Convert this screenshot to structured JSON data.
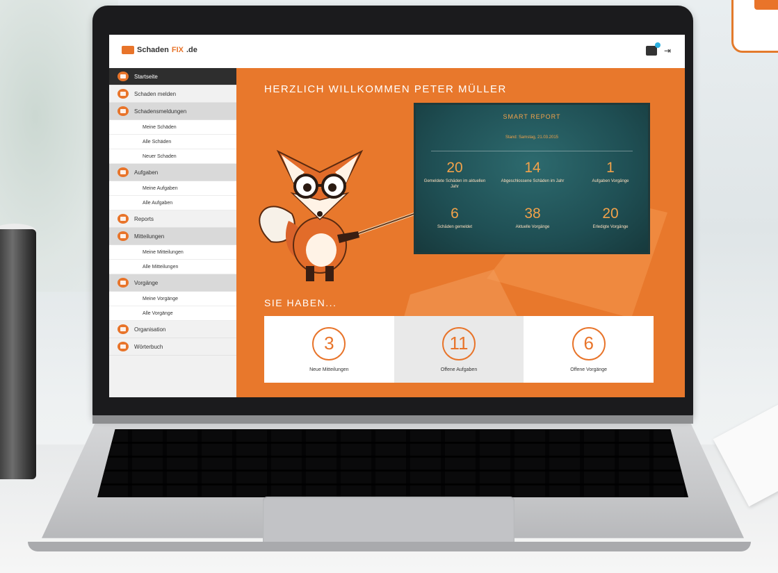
{
  "app": {
    "logo_text": "Schaden",
    "logo_accent": "FIX",
    "logo_suffix": ".de"
  },
  "sidebar": {
    "items": [
      {
        "label": "Startseite",
        "active": true
      },
      {
        "label": "Schaden melden"
      },
      {
        "label": "Schadensmeldungen",
        "section": true
      },
      {
        "sub": "Meine Schäden"
      },
      {
        "sub": "Alle Schäden"
      },
      {
        "sub": "Neuer Schaden"
      },
      {
        "label": "Aufgaben",
        "section": true
      },
      {
        "sub": "Meine Aufgaben"
      },
      {
        "sub": "Alle Aufgaben"
      },
      {
        "label": "Reports"
      },
      {
        "label": "Mitteilungen",
        "section": true
      },
      {
        "sub": "Meine Mitteilungen"
      },
      {
        "sub": "Alle Mitteilungen"
      },
      {
        "label": "Vorgänge",
        "section": true
      },
      {
        "sub": "Meine Vorgänge"
      },
      {
        "sub": "Alle Vorgänge"
      },
      {
        "label": "Organisation"
      },
      {
        "label": "Wörterbuch"
      }
    ]
  },
  "main": {
    "welcome": "HERZLICH WILLKOMMEN PETER MÜLLER",
    "board": {
      "title": "SMART REPORT",
      "subtitle": "Stand: Samstag, 21.03.2015",
      "stats": [
        {
          "value": "20",
          "label": "Gemeldete Schäden im aktuellen Jahr"
        },
        {
          "value": "14",
          "label": "Abgeschlossene Schäden im Jahr"
        },
        {
          "value": "1",
          "label": "Aufgaben Vorgänge"
        },
        {
          "value": "6",
          "label": "Schäden gemeldet"
        },
        {
          "value": "38",
          "label": "Aktuelle Vorgänge"
        },
        {
          "value": "20",
          "label": "Erledigte Vorgänge"
        }
      ]
    },
    "haben_label": "SIE HABEN...",
    "cards": [
      {
        "value": "3",
        "label": "Neue Mitteilungen"
      },
      {
        "value": "11",
        "label": "Offene Aufgaben"
      },
      {
        "value": "6",
        "label": "Offene Vorgänge"
      }
    ]
  },
  "colors": {
    "accent": "#e8782c",
    "board": "#1f4f54",
    "board_text": "#f2a24a"
  }
}
